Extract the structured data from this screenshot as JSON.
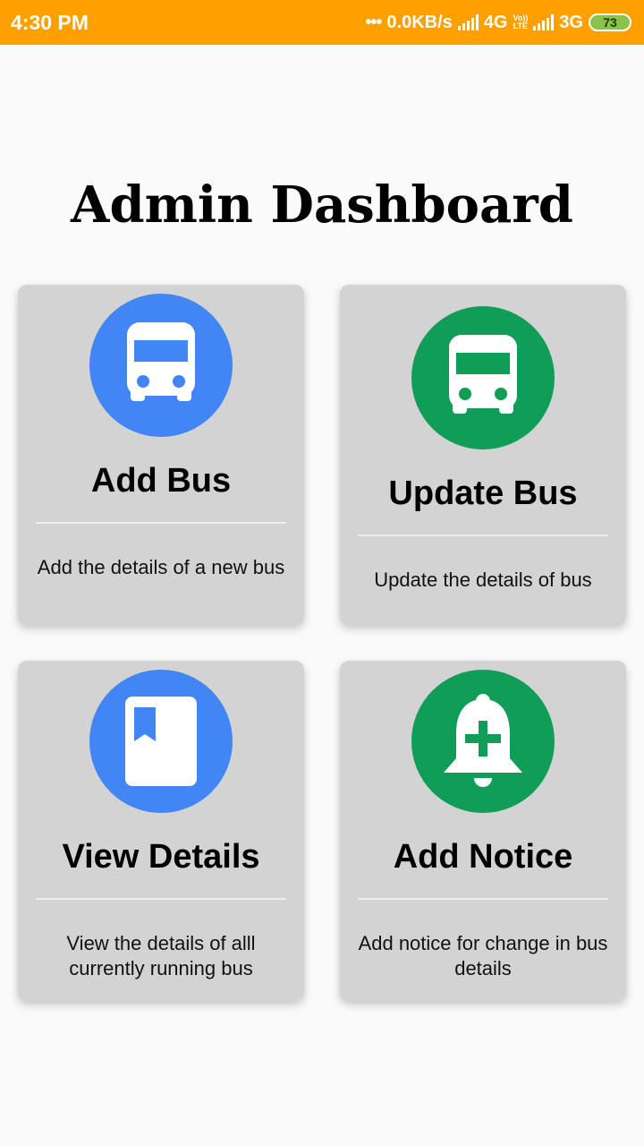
{
  "status_bar": {
    "time": "4:30 PM",
    "data_rate": "0.0KB/s",
    "network1": "4G",
    "volte_top": "Vo))",
    "volte_bottom": "LTE",
    "network2": "3G",
    "battery": "73"
  },
  "page": {
    "title": "Admin Dashboard"
  },
  "cards": [
    {
      "title": "Add Bus",
      "description": "Add the details of a new bus",
      "icon": "bus-icon",
      "color": "#4285f4"
    },
    {
      "title": "Update Bus",
      "description": "Update the details of bus",
      "icon": "bus-icon",
      "color": "#0f9d58"
    },
    {
      "title": "View Details",
      "description": "View the details of alll currently running bus",
      "icon": "book-icon",
      "color": "#4285f4"
    },
    {
      "title": "Add Notice",
      "description": "Add notice for change in bus details",
      "icon": "notification-add-icon",
      "color": "#0f9d58"
    }
  ],
  "colors": {
    "status_bar": "#ffa000",
    "card_bg": "#d3d3d3",
    "blue": "#4285f4",
    "green": "#0f9d58"
  }
}
